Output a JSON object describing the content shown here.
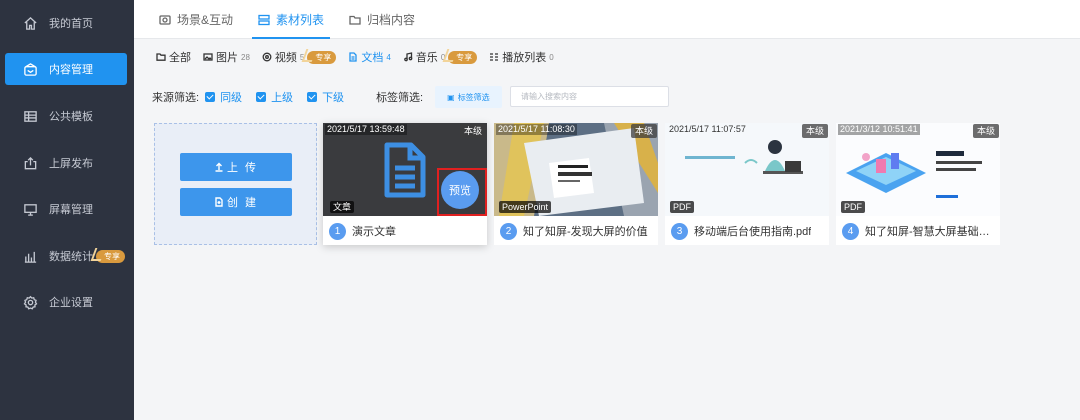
{
  "sidebar": {
    "items": [
      {
        "label": "我的首页",
        "icon": "home-icon"
      },
      {
        "label": "内容管理",
        "icon": "content-icon",
        "active": true
      },
      {
        "label": "公共模板",
        "icon": "template-icon"
      },
      {
        "label": "上屏发布",
        "icon": "publish-icon"
      },
      {
        "label": "屏幕管理",
        "icon": "monitor-icon"
      },
      {
        "label": "数据统计",
        "icon": "chart-icon",
        "badge": "专享"
      },
      {
        "label": "企业设置",
        "icon": "gear-icon"
      }
    ]
  },
  "tabs": [
    {
      "label": "场景&互动",
      "icon": "scene-icon"
    },
    {
      "label": "素材列表",
      "icon": "list-icon",
      "active": true
    },
    {
      "label": "归档内容",
      "icon": "folder-icon"
    }
  ],
  "filters": {
    "all": "全部",
    "image": {
      "label": "图片",
      "count": "28"
    },
    "video": {
      "label": "视频",
      "count": "5",
      "badge": "专享"
    },
    "doc": {
      "label": "文档",
      "count": "4"
    },
    "music": {
      "label": "音乐",
      "count": "0",
      "badge": "专享"
    },
    "playlist": {
      "label": "播放列表",
      "count": "0"
    }
  },
  "source_filter": {
    "label": "来源筛选:",
    "options": [
      "同级",
      "上级",
      "下级"
    ]
  },
  "tag_filter": {
    "label": "标签筛选:",
    "button": "标签筛选"
  },
  "search": {
    "placeholder": "请输入搜索内容"
  },
  "upload": {
    "upload_label": "上 传",
    "create_label": "创 建"
  },
  "cards": [
    {
      "index": "1",
      "timestamp": "2021/5/17 13:59:48",
      "level": "本级",
      "type": "文章",
      "title": "演示文章",
      "preview": "预览"
    },
    {
      "index": "2",
      "timestamp": "2021/5/17 11:08:30",
      "level": "本级",
      "type": "PowerPoint",
      "title": "知了知屏-发现大屏的价值"
    },
    {
      "index": "3",
      "timestamp": "2021/5/17 11:07:57",
      "level": "本级",
      "type": "PDF",
      "title": "移动端后台使用指南.pdf"
    },
    {
      "index": "4",
      "timestamp": "2021/3/12 10:51:41",
      "level": "本级",
      "type": "PDF",
      "title": "知了知屏-智慧大屏基础功能介绍"
    }
  ],
  "colors": {
    "sidebar_bg": "#2d3340",
    "accent": "#2093f0",
    "badge": "#d99a3e"
  }
}
